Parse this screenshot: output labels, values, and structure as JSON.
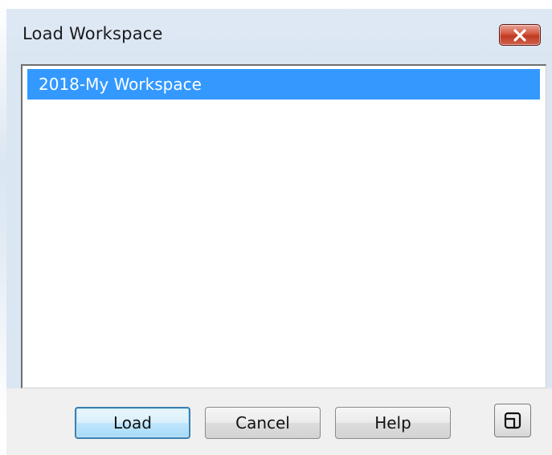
{
  "window": {
    "title": "Load Workspace"
  },
  "titlebar": {
    "close_icon": "close-icon"
  },
  "workspace_list": {
    "items": [
      {
        "label": "2018-My Workspace",
        "selected": true
      }
    ]
  },
  "buttons": {
    "load_label": "Load",
    "cancel_label": "Cancel",
    "help_label": "Help",
    "restore_icon": "window-restore-icon"
  },
  "colors": {
    "selection": "#3399ff",
    "titlebar": "#dbe6f3",
    "close_button": "#c7432b",
    "default_button_border": "#3c7fb1"
  }
}
